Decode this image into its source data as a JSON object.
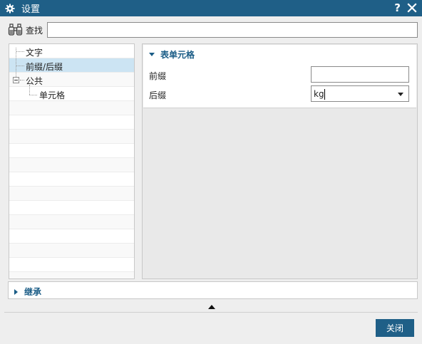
{
  "window": {
    "title": "设置",
    "help_label": "?"
  },
  "find": {
    "label": "查找",
    "value": ""
  },
  "tree": {
    "items": [
      {
        "label": "文字"
      },
      {
        "label": "前缀/后缀",
        "selected": true
      },
      {
        "label": "公共"
      },
      {
        "label": "单元格"
      }
    ]
  },
  "group": {
    "title": "表单元格",
    "prefix_label": "前缀",
    "prefix_value": "",
    "suffix_label": "后缀",
    "suffix_value": "kg"
  },
  "inherit": {
    "title": "继承"
  },
  "footer": {
    "close_label": "关闭"
  },
  "colors": {
    "accent": "#1f5f87",
    "selection": "#cce4f3"
  }
}
